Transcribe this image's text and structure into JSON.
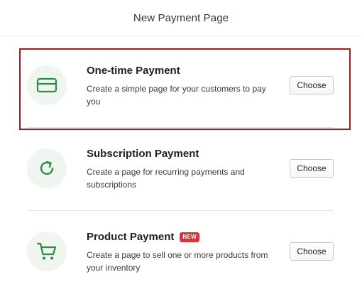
{
  "header": {
    "title": "New Payment Page"
  },
  "options": [
    {
      "id": "one-time",
      "icon": "credit-card-icon",
      "title": "One-time Payment",
      "description": "Create a simple page for your customers to pay you",
      "button_label": "Choose",
      "highlighted": true
    },
    {
      "id": "subscription",
      "icon": "refresh-icon",
      "title": "Subscription Payment",
      "description": "Create a page for recurring payments and subscriptions",
      "button_label": "Choose"
    },
    {
      "id": "product",
      "icon": "shopping-cart-icon",
      "title": "Product Payment",
      "badge": "NEW",
      "description": "Create a page to sell one or more products from your inventory",
      "button_label": "Choose"
    }
  ],
  "colors": {
    "icon_green": "#2e8b45",
    "icon_bg": "#eef6ef",
    "badge_red": "#d6333a",
    "highlight_border": "#a31b1b"
  }
}
